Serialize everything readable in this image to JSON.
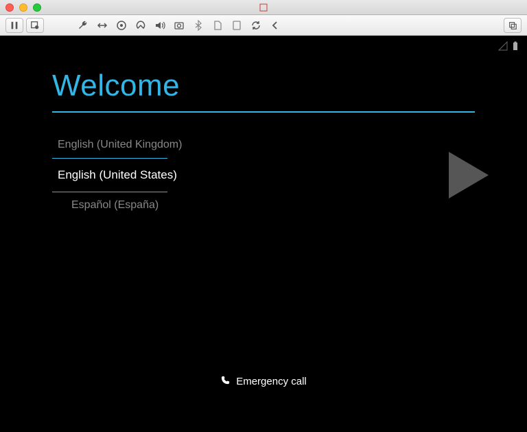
{
  "welcome": {
    "title": "Welcome"
  },
  "languages": {
    "prev": "English (United Kingdom)",
    "selected": "English (United States)",
    "next": "Español (España)"
  },
  "emergency": {
    "label": "Emergency call"
  }
}
